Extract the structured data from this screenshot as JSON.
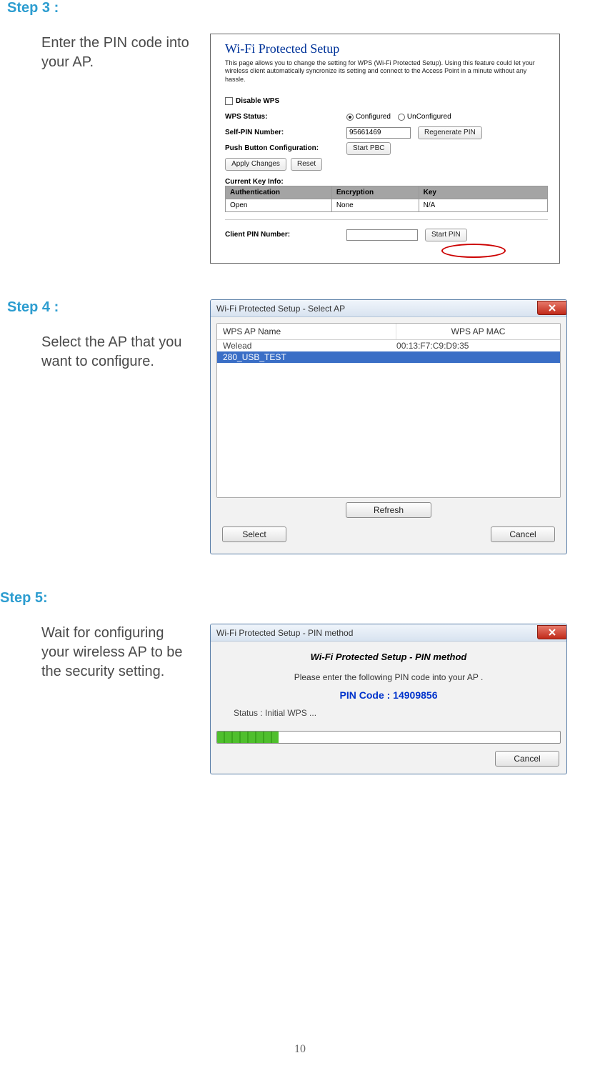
{
  "page_number": "10",
  "step3": {
    "heading": "Step 3 :",
    "body": "Enter the PIN code into your AP.",
    "title": "Wi-Fi Protected Setup",
    "desc": "This page allows you to change the setting for WPS (Wi-Fi Protected Setup). Using this feature could let your wireless client automatically syncronize its setting and connect to the Access Point in a minute without any hassle.",
    "disable_label": "Disable WPS",
    "wps_status_label": "WPS Status:",
    "status_configured": "Configured",
    "status_unconfigured": "UnConfigured",
    "selfpin_label": "Self-PIN Number:",
    "selfpin_value": "95661469",
    "regen_btn": "Regenerate PIN",
    "pbc_label": "Push Button Configuration:",
    "startpbc_btn": "Start PBC",
    "apply_btn": "Apply Changes",
    "reset_btn": "Reset",
    "keyinfo_label": "Current Key Info:",
    "th_auth": "Authentication",
    "th_enc": "Encryption",
    "th_key": "Key",
    "td_auth": "Open",
    "td_enc": "None",
    "td_key": "N/A",
    "clientpin_label": "Client PIN Number:",
    "clientpin_value": "",
    "startpin_btn": "Start PIN"
  },
  "step4": {
    "heading": "Step 4 :",
    "body": "Select the AP that you want to configure.",
    "window_title": "Wi-Fi Protected Setup - Select AP",
    "col_name": "WPS AP Name",
    "col_mac": "WPS AP MAC",
    "rows": [
      {
        "name": "Welead",
        "mac": "00:13:F7:C9:D9:35"
      },
      {
        "name": "280_USB_TEST",
        "mac": ""
      }
    ],
    "refresh_btn": "Refresh",
    "select_btn": "Select",
    "cancel_btn": "Cancel"
  },
  "step5": {
    "heading": "Step 5:",
    "body": "Wait for configuring your wireless AP to be the security setting.",
    "window_title": "Wi-Fi Protected Setup - PIN method",
    "content_title": "Wi-Fi Protected Setup - PIN method",
    "msg": "Please enter the following PIN code into your AP .",
    "pin_label": "PIN Code :  14909856",
    "status": "Status : Initial WPS ...",
    "cancel_btn": "Cancel"
  }
}
